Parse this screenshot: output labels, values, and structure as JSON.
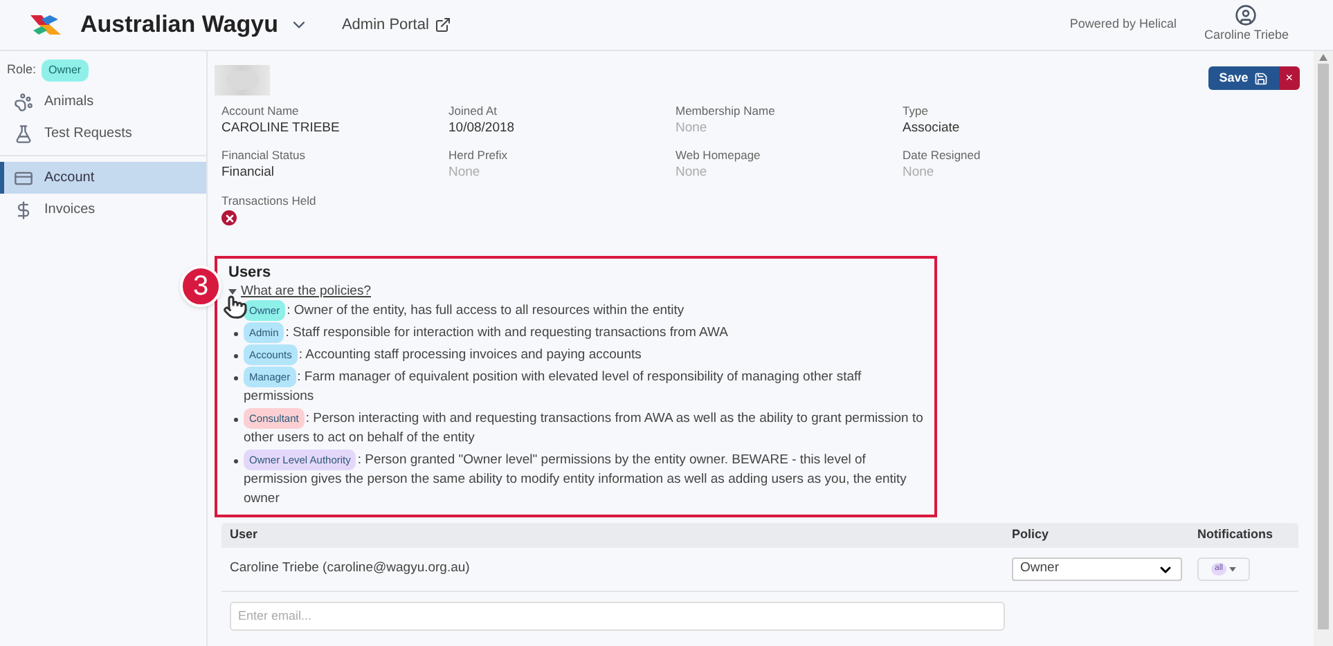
{
  "header": {
    "brand": "Australian Wagyu",
    "admin_link": "Admin Portal",
    "powered_by": "Powered by Helical",
    "user_name": "Caroline Triebe"
  },
  "sidebar": {
    "role_label": "Role:",
    "role_badge": "Owner",
    "items": [
      {
        "label": "Animals",
        "kind": "animals",
        "selected": false
      },
      {
        "label": "Test Requests",
        "kind": "tests",
        "selected": false
      },
      {
        "label": "Account",
        "kind": "account",
        "selected": true
      },
      {
        "label": "Invoices",
        "kind": "invoices",
        "selected": false
      }
    ]
  },
  "actions": {
    "save": "Save",
    "cancel": "×"
  },
  "fields": [
    {
      "label": "Account Name",
      "value": "CAROLINE TRIEBE",
      "empty": false
    },
    {
      "label": "Joined At",
      "value": "10/08/2018",
      "empty": false
    },
    {
      "label": "Membership Name",
      "value": "None",
      "empty": true
    },
    {
      "label": "Type",
      "value": "Associate",
      "empty": false
    },
    {
      "label": "Financial Status",
      "value": "Financial",
      "empty": false
    },
    {
      "label": "Herd Prefix",
      "value": "None",
      "empty": true
    },
    {
      "label": "Web Homepage",
      "value": "None",
      "empty": true
    },
    {
      "label": "Date Resigned",
      "value": "None",
      "empty": true
    }
  ],
  "transactions_held": {
    "label": "Transactions Held",
    "held": false
  },
  "users": {
    "title": "Users",
    "policies_toggle": "What are the policies?",
    "expanded": true,
    "callout_step": "3",
    "policies": [
      {
        "badge": "Owner",
        "color": "#8ff0ea",
        "description": ": Owner of the entity, has full access to all resources within the entity"
      },
      {
        "badge": "Admin",
        "color": "#b3e5fa",
        "description": ": Staff responsible for interaction with and requesting transactions from AWA"
      },
      {
        "badge": "Accounts",
        "color": "#b3e5fa",
        "description": ": Accounting staff processing invoices and paying accounts"
      },
      {
        "badge": "Manager",
        "color": "#b3e5fa",
        "description": ": Farm manager of equivalent position with elevated level of responsibility of managing other staff permissions"
      },
      {
        "badge": "Consultant",
        "color": "#fcd0d3",
        "description": ": Person interacting with and requesting transactions from AWA as well as the ability to grant permission to other users to act on behalf of the entity"
      },
      {
        "badge": "Owner Level Authority",
        "color": "#e4d8fa",
        "description": ": Person granted \"Owner level\" permissions by the entity owner. BEWARE - this level of permission gives the person the same ability to modify entity information as well as adding users as you, the entity owner"
      }
    ],
    "table": {
      "columns": [
        "User",
        "Policy",
        "Notifications"
      ],
      "rows": [
        {
          "user": "Caroline Triebe (caroline@wagyu.org.au)",
          "policy": "Owner",
          "notifications": "all"
        }
      ],
      "email_placeholder": "Enter email..."
    }
  }
}
